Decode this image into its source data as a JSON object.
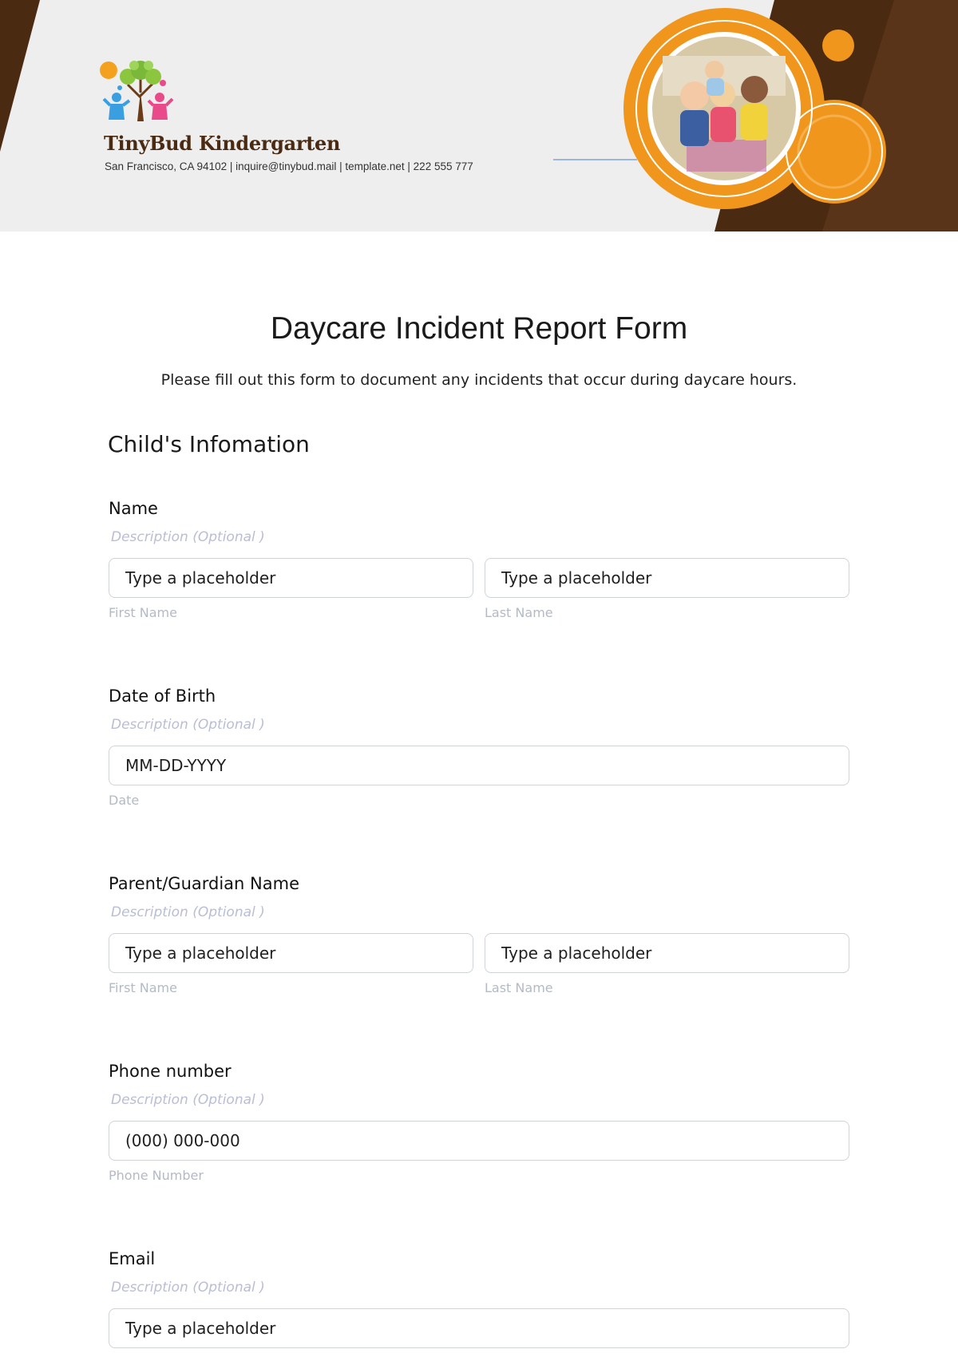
{
  "header": {
    "brand_name": "TinyBud Kindergarten",
    "contact": "San Francisco, CA 94102 | inquire@tinybud.mail | template.net | 222 555 777",
    "colors": {
      "brown": "#4b2a12",
      "orange": "#f0961c",
      "light_bg": "#eeeeee"
    }
  },
  "form": {
    "title": "Daycare Incident Report Form",
    "subtitle": "Please fill out this form to document any incidents that occur during daycare hours.",
    "section_title": "Child's Infomation",
    "fields": {
      "name": {
        "label": "Name",
        "description": "Description  (Optional )",
        "first_placeholder": "Type a placeholder",
        "first_sub": "First Name",
        "last_placeholder": "Type a placeholder",
        "last_sub": "Last Name"
      },
      "dob": {
        "label": "Date of Birth",
        "description": "Description  (Optional )",
        "placeholder": "MM-DD-YYYY",
        "sub": "Date"
      },
      "guardian": {
        "label": "Parent/Guardian Name",
        "description": "Description  (Optional )",
        "first_placeholder": "Type a placeholder",
        "first_sub": "First Name",
        "last_placeholder": "Type a placeholder",
        "last_sub": "Last Name"
      },
      "phone": {
        "label": "Phone number",
        "description": "Description  (Optional )",
        "placeholder": "(000) 000-000",
        "sub": "Phone Number"
      },
      "email": {
        "label": "Email",
        "description": "Description  (Optional )",
        "placeholder": "Type a placeholder"
      }
    }
  }
}
